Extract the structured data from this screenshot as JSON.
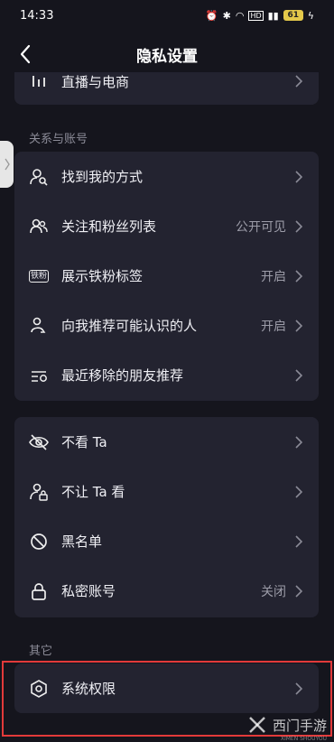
{
  "status_bar": {
    "time": "14:33",
    "battery": "61"
  },
  "nav": {
    "title": "隐私设置"
  },
  "top_partial": {
    "label": "直播与电商"
  },
  "section_relations": {
    "title": "关系与账号"
  },
  "relations_items": [
    {
      "label": "找到我的方式",
      "value": ""
    },
    {
      "label": "关注和粉丝列表",
      "value": "公开可见"
    },
    {
      "label": "展示铁粉标签",
      "value": "开启"
    },
    {
      "label": "向我推荐可能认识的人",
      "value": "开启"
    },
    {
      "label": "最近移除的朋友推荐",
      "value": ""
    }
  ],
  "badge_icon_text": "铁粉",
  "privacy_items": [
    {
      "label": "不看 Ta",
      "value": ""
    },
    {
      "label": "不让 Ta 看",
      "value": ""
    },
    {
      "label": "黑名单",
      "value": ""
    },
    {
      "label": "私密账号",
      "value": "关闭"
    }
  ],
  "section_other": {
    "title": "其它"
  },
  "other_items": [
    {
      "label": "系统权限",
      "value": ""
    }
  ],
  "watermark": {
    "text": "西门手游",
    "sub": "XIMEN SHOUYOU"
  }
}
